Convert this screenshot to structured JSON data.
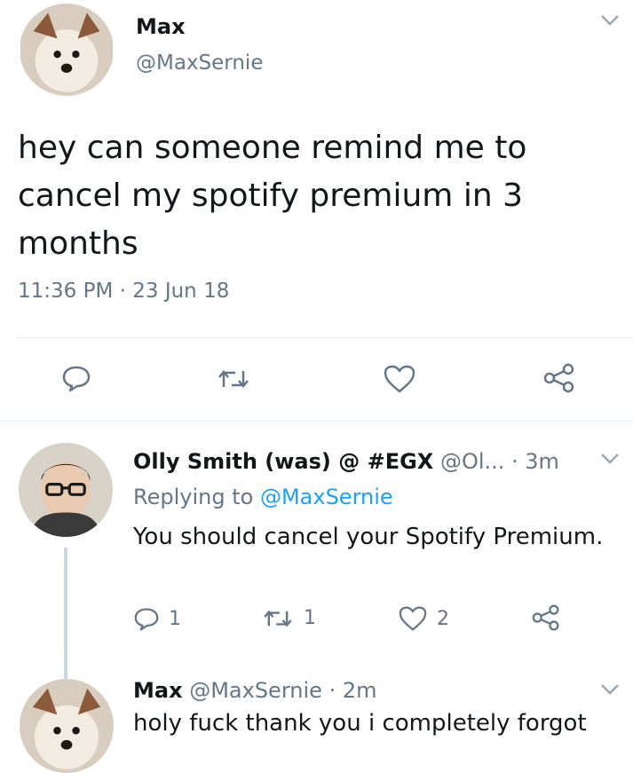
{
  "main_tweet": {
    "author_name": "Max",
    "author_handle": "@MaxSernie",
    "text": "hey can someone remind me to cancel my spotify premium in 3 months",
    "timestamp": "11:36 PM · 23 Jun 18",
    "actions": {
      "reply_icon": "reply-icon",
      "retweet_icon": "retweet-icon",
      "like_icon": "heart-icon",
      "share_icon": "share-icon"
    }
  },
  "reply_1": {
    "author_name": "Olly Smith (was) @ #EGX",
    "author_handle": "@Ol...",
    "time": "· 3m",
    "replying_prefix": "Replying to",
    "replying_handle": "@MaxSernie",
    "text": "You should cancel your Spotify Premium.",
    "reply_count": "1",
    "retweet_count": "1",
    "like_count": "2"
  },
  "reply_2": {
    "author_name": "Max",
    "author_handle": "@MaxSernie",
    "time": "· 2m",
    "text": "holy fuck thank you i completely forgot"
  },
  "colors": {
    "text": "#14171a",
    "secondary": "#657786",
    "link": "#1da1f2",
    "divider": "#e1e8ed"
  }
}
